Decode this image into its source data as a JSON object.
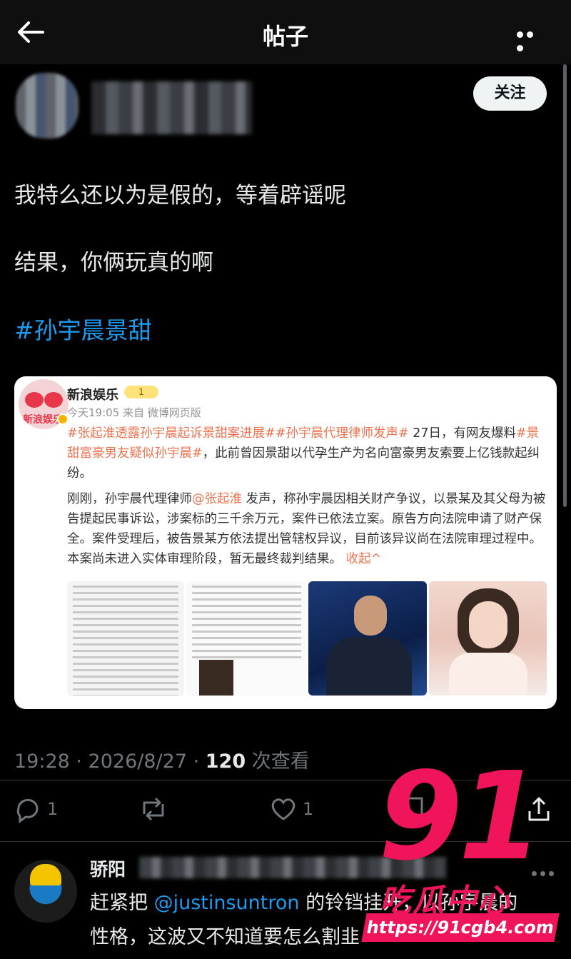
{
  "header": {
    "title": "帖子"
  },
  "post": {
    "follow_label": "关注",
    "line1": "我特么还以为是假的，等着辟谣呢",
    "line2": "结果，你俩玩真的啊",
    "hashtag": "#孙宇晨景甜",
    "card": {
      "source_name": "新浪娱乐",
      "level_badge": "1",
      "meta": "今天19:05 来自 微博网页版",
      "logo_text": "新浪娱乐",
      "p1_tag1": "#张起淮透露孙宇晨起诉景甜案进展#",
      "p1_tag2": "#孙宇晨代理律师发声#",
      "p1_text1": " 27日，有网友爆料",
      "p1_tag3": "#景甜富豪男友疑似孙宇晨#",
      "p1_text2": "，此前曾因景甜以代孕生产为名向富豪男友索要上亿钱款起纠纷。",
      "p2_text1": "刚刚，孙宇晨代理律师",
      "p2_mention": "@张起淮",
      "p2_text2": " 发声，称孙宇晨因相关财产争议，以景某及其父母为被告提起民事诉讼，涉案标的三千余万元，案件已依法立案。原告方向法院申请了财产保全。案件受理后，被告景某方依法提出管辖权异议，目前该异议尚在法院审理过程中。本案尚未进入实体审理阶段，暂无最终裁判结果。",
      "collapse_label": "收起^",
      "thumbnail_icons": [
        "document-thumbnail",
        "document-thumbnail",
        "man-photo",
        "woman-photo"
      ]
    },
    "timestamp_prefix": "19:28 · 2026/8/27 · ",
    "views_count": "120",
    "views_label": " 次查看",
    "actions": {
      "reply_count": "1",
      "like_count": "1",
      "icons": [
        "reply-icon",
        "repost-icon",
        "like-icon",
        "bookmark-icon",
        "share-icon"
      ]
    }
  },
  "watermark": {
    "number": "91",
    "text": "吃瓜中心",
    "url": "https://91cgb4.com"
  },
  "reply": {
    "name": "骄阳",
    "text_before": "赶紧把 ",
    "mention": "@justinsuntron",
    "text_after": " 的铃铛挂开，以孙宇晨的",
    "line2": "性格，这波又不知道要怎么割韭"
  },
  "colors": {
    "background": "#000000",
    "accent": "#1d9bf0",
    "weibo_orange": "#eb7350",
    "watermark": "#f0145a"
  }
}
